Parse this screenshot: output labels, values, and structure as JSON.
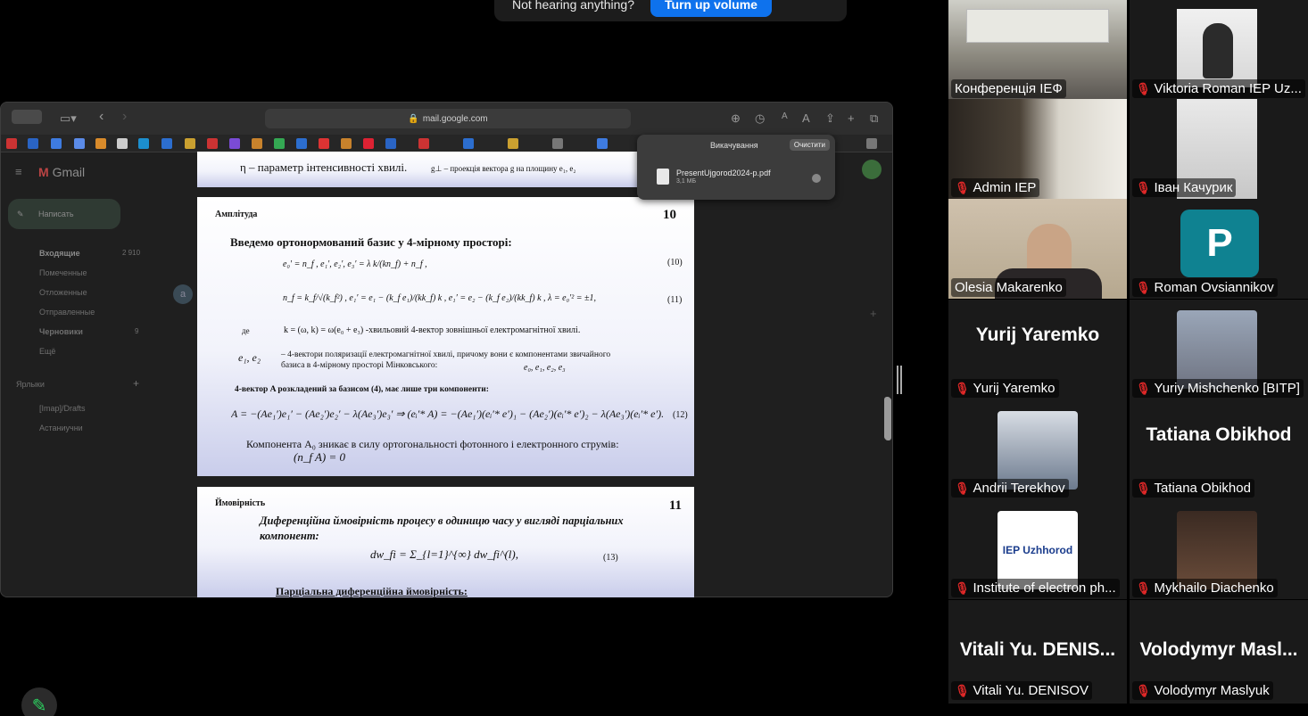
{
  "banner": {
    "text": "Not hearing anything?",
    "button": "Turn up volume"
  },
  "browser": {
    "url": "mail.google.com",
    "downloads": {
      "title": "Викачування",
      "clear_label": "Очистити",
      "file_name": "PresentUjgorod2024-p.pdf",
      "file_size": "3,1 МБ"
    }
  },
  "gmail": {
    "logo": "Gmail",
    "compose": "Написать",
    "nav": [
      {
        "label": "Входящие",
        "count": "2 910"
      },
      {
        "label": "Помеченные",
        "count": ""
      },
      {
        "label": "Отложенные",
        "count": ""
      },
      {
        "label": "Отправленные",
        "count": ""
      },
      {
        "label": "Черновики",
        "count": "9"
      },
      {
        "label": "Ещё",
        "count": ""
      }
    ],
    "labels_header": "Ярлыки",
    "labels": [
      "[Imap]/Drafts",
      "Астаниучни"
    ]
  },
  "slides": {
    "top_fragment_1": "η – параметр інтенсивності хвилі.",
    "top_fragment_2": "g⊥ – проекція вектора g на площину e₁, e₂",
    "amplitude": {
      "section": "Амплітуда",
      "number": "10",
      "heading": "Введемо ортонормований базис у 4-мірному просторі:",
      "eq10": "e₀′ = n_f , e₁′, e₂′, e₃′ = λ k/(kn_f) + n_f ,",
      "eq10_num": "(10)",
      "eq11": "n_f = k_f/√(k_f²) , e₁′ = e₁ − (k_f e₁)/(kk_f) k , e₁′ = e₂ − (k_f e₂)/(kk_f) k , λ = e₀′² = ±1,",
      "eq11_num": "(11)",
      "where": "де",
      "k_def": "k = (ω, k) = ω(e₀ + e₃)  -хвильовий 4-вектор зовнішньої електромагнітної хвилі.",
      "pol_symbols": "e₁,   e₂",
      "pol_text": "– 4-вектори поляризації електромагнітної хвилі, причому вони є компонентами звичайного базиса в 4-мірному просторі Мінковського:",
      "pol_basis": "e₀, e₁, e₂, e₃",
      "decomp": "4-вектор A розкладений за базисом (4), має лише три компоненти:",
      "eq12": "A = −(Ae₁′)e₁′ − (Ae₂′)e₂′ − λ(Ae₃′)e₃′ ⇒ (eᵢ′* A) = −(Ae₁′)(eᵢ′* e′)₁ − (Ae₂′)(eᵢ′* e′)₂ − λ(Ae₃′)(eᵢ′* e′).",
      "eq12_num": "(12)",
      "component": "Компонента  A₀ зникає в силу ортогональності фотонного і електронного струмів:",
      "component_eq": "(n_f A) = 0"
    },
    "probability": {
      "section": "Ймовірність",
      "number": "11",
      "heading": "Диференційна ймовірність процесу в одиницю часу у вигляді парціальних компонент:",
      "eq13": "dw_fi = Σ_{l=1}^{∞} dw_fi^(l),",
      "eq13_num": "(13)",
      "partial": "Парціальна диференційна ймовірність:"
    }
  },
  "participants": [
    {
      "name": "Конференція ІЕФ",
      "muted": false,
      "kind": "video"
    },
    {
      "name": "Viktoria Roman IEP Uz...",
      "muted": true,
      "kind": "video"
    },
    {
      "name": "Admin IEP",
      "muted": true,
      "kind": "video"
    },
    {
      "name": "Іван Качурик",
      "muted": true,
      "kind": "video"
    },
    {
      "name": "Olesia Makarenko",
      "muted": false,
      "kind": "video",
      "active": true
    },
    {
      "name": "Roman Ovsiannikov",
      "muted": true,
      "kind": "avatar",
      "initial": "P"
    },
    {
      "name": "Yurij Yaremko",
      "muted": true,
      "kind": "text",
      "big": "Yurij Yaremko"
    },
    {
      "name": "Yuriy Mishchenko [BITP]",
      "muted": true,
      "kind": "photo"
    },
    {
      "name": "Andrii Terekhov",
      "muted": true,
      "kind": "photo"
    },
    {
      "name": "Tatiana Obikhod",
      "muted": true,
      "kind": "text",
      "big": "Tatiana Obikhod"
    },
    {
      "name": "Institute of electron ph...",
      "muted": true,
      "kind": "logo",
      "logo_text": "IEP Uzhhorod"
    },
    {
      "name": "Mykhailo Diachenko",
      "muted": true,
      "kind": "photo"
    },
    {
      "name": "Vitali Yu. DENISOV",
      "muted": true,
      "kind": "text",
      "big": "Vitali Yu. DENIS..."
    },
    {
      "name": "Volodymyr Maslyuk",
      "muted": true,
      "kind": "text",
      "big": "Volodymyr Masl..."
    }
  ],
  "colors": {
    "accent_green": "#23d959",
    "zoom_blue": "#0e72ed",
    "avatar_teal": "#0f8291",
    "muted_red": "#e02828"
  }
}
